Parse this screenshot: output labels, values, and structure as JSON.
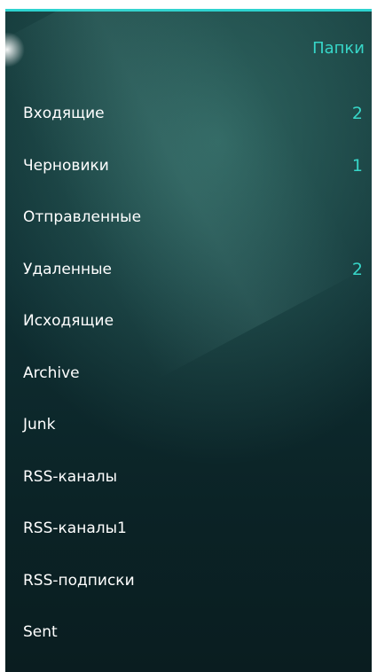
{
  "header": {
    "title": "Папки"
  },
  "folders": [
    {
      "label": "Входящие",
      "count": "2"
    },
    {
      "label": "Черновики",
      "count": "1"
    },
    {
      "label": "Отправленные",
      "count": ""
    },
    {
      "label": "Удаленные",
      "count": "2"
    },
    {
      "label": "Исходящие",
      "count": ""
    },
    {
      "label": "Archive",
      "count": ""
    },
    {
      "label": "Junk",
      "count": ""
    },
    {
      "label": "RSS-каналы",
      "count": ""
    },
    {
      "label": "RSS-каналы1",
      "count": ""
    },
    {
      "label": "RSS-подписки",
      "count": ""
    },
    {
      "label": "Sent",
      "count": ""
    }
  ],
  "colors": {
    "accent": "#37d6c8",
    "top_line": "#2dd3cf",
    "background": "#0f2f33",
    "text": "#ffffff"
  }
}
